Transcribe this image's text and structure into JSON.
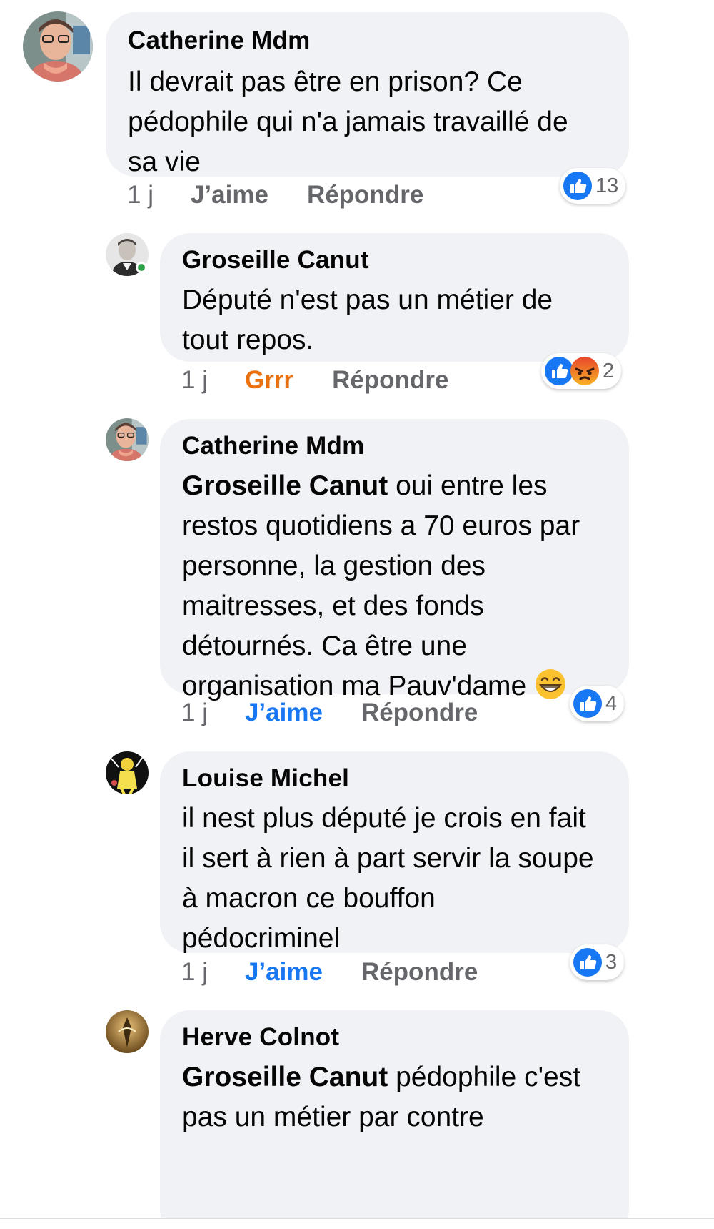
{
  "comments": [
    {
      "author": "Catherine Mdm",
      "lines": [
        "Il devrait pas être en prison? Ce",
        "pédophile qui n'a jamais travaillé de",
        "sa vie"
      ],
      "time": "1 j",
      "like_label": "J’aime",
      "reply_label": "Répondre",
      "reaction_count": "13",
      "reactions": [
        "like-reaction-icon"
      ],
      "avatar": "catherine-avatar"
    },
    {
      "author": "Groseille Canut",
      "lines": [
        "Député n'est pas un métier de",
        "tout repos."
      ],
      "time": "1 j",
      "like_label": "Grrr",
      "reply_label": "Répondre",
      "reaction_count": "2",
      "reactions": [
        "like-reaction-icon",
        "angry-reaction-icon"
      ],
      "avatar": "groseille-avatar",
      "online": true
    },
    {
      "author": "Catherine Mdm",
      "mention": "Groseille Canut",
      "first_line_rest": " oui entre les",
      "lines": [
        "restos quotidiens a 70 euros par",
        "personne, la gestion des",
        "maitresses, et des fonds",
        "détournés. Ca être une",
        "organisation ma Pauv'dame"
      ],
      "emoji": "grinning-emoji",
      "time": "1 j",
      "like_label": "J’aime",
      "reply_label": "Répondre",
      "reaction_count": "4",
      "reactions": [
        "like-reaction-icon"
      ],
      "avatar": "catherine-avatar"
    },
    {
      "author": "Louise Michel",
      "lines": [
        "il nest plus député je crois en fait",
        "il sert à rien à part servir la soupe",
        "à macron ce bouffon",
        "pédocriminel"
      ],
      "time": "1 j",
      "like_label": "J’aime",
      "reply_label": "Répondre",
      "reaction_count": "3",
      "reactions": [
        "like-reaction-icon"
      ],
      "avatar": "louise-avatar"
    },
    {
      "author": "Herve Colnot",
      "mention": "Groseille Canut",
      "first_line_rest": " pédophile c'est",
      "lines": [
        "pas un métier par contre"
      ],
      "avatar": "herve-avatar"
    }
  ],
  "colors": {
    "bubble": "#f0f2f5",
    "like_active": "#1877f2",
    "grrr": "#e9710f",
    "secondary_text": "#65676b",
    "online": "#31a24c"
  }
}
